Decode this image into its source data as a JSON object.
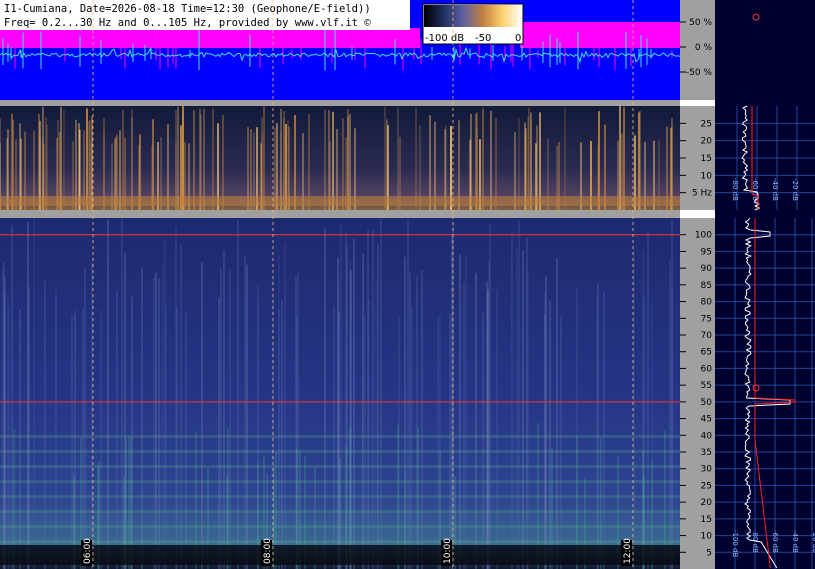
{
  "header": {
    "line1": "I1-Cumiana, Date=2026-08-18 Time=12:30 (Geophone/E-field))",
    "line2": "Freq= 0.2...30 Hz and 0...105 Hz, provided by www.vlf.it ©"
  },
  "colorbar": {
    "labels": [
      "-100 dB",
      "-50",
      "0"
    ],
    "gradient": [
      "#000000",
      "#203060",
      "#6060a0",
      "#c08040",
      "#ffd070",
      "#ffffff"
    ]
  },
  "colors": {
    "amplitude_bg": "#0000ff",
    "amplitude_band": "#ff00ff",
    "amplitude_trace": "#40e0e0",
    "axis_panel": "#a0a0a0",
    "spectrum_trace": "#ffffff",
    "mean_trace": "#ff2020",
    "gridline": "#f0c080"
  },
  "time_labels": [
    "06:00",
    "08:00",
    "10:00",
    "12:00"
  ],
  "chart_data": [
    {
      "type": "line",
      "panel": "amplitude",
      "yticks": [
        "50 %",
        "0 %",
        "-50 %"
      ],
      "values": [
        50,
        0,
        -50
      ]
    },
    {
      "type": "heatmap",
      "panel": "spectrogram-low",
      "yticks": [
        "25",
        "20",
        "15",
        "10",
        "5 Hz"
      ],
      "values": [
        25,
        20,
        15,
        10,
        5
      ],
      "ylim": [
        0,
        30
      ]
    },
    {
      "type": "heatmap",
      "panel": "spectrogram-high",
      "yticks": [
        "100",
        "95",
        "90",
        "85",
        "80",
        "75",
        "70",
        "65",
        "60",
        "55",
        "50",
        "45",
        "40",
        "35",
        "30",
        "25",
        "20",
        "15",
        "10",
        "5"
      ],
      "values": [
        100,
        95,
        90,
        85,
        80,
        75,
        70,
        65,
        60,
        55,
        50,
        45,
        40,
        35,
        30,
        25,
        20,
        15,
        10,
        5
      ],
      "ylim": [
        0,
        105
      ],
      "emission_lines_hz": [
        100,
        50
      ]
    },
    {
      "type": "line",
      "panel": "side-spectrum",
      "axis_labels_low": [
        "-80 dB",
        "-60 dB",
        "-40 dB",
        "-20 dB"
      ],
      "axis_labels_high": [
        "-100 dB",
        "-80 dB",
        "-60 dB",
        "-40 dB",
        "-20 dB"
      ]
    }
  ]
}
